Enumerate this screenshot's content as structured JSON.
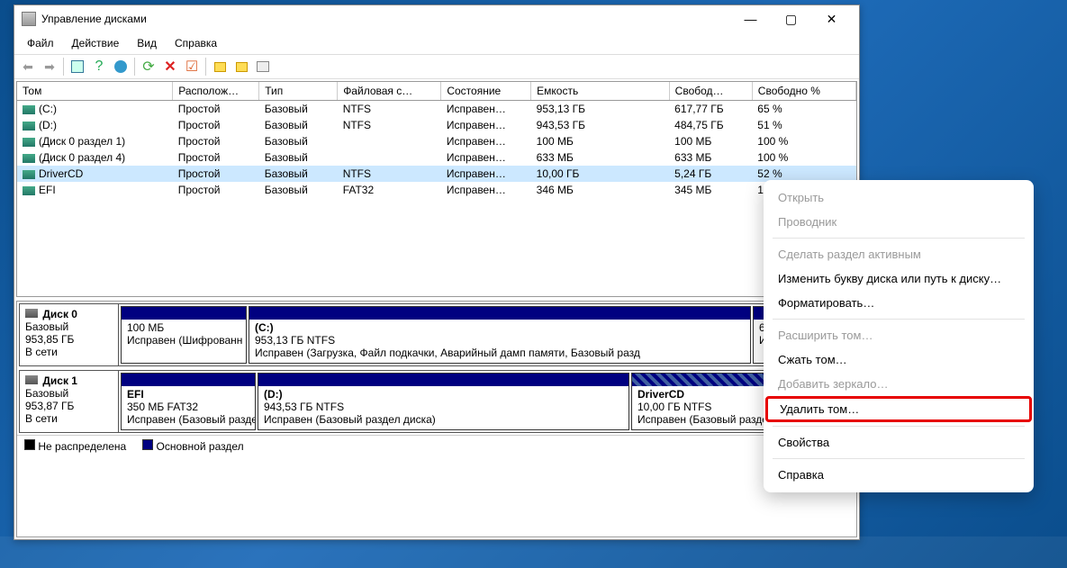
{
  "window": {
    "title": "Управление дисками",
    "controls": {
      "min": "—",
      "max": "▢",
      "close": "✕"
    }
  },
  "menubar": [
    "Файл",
    "Действие",
    "Вид",
    "Справка"
  ],
  "columns": {
    "c0": "Том",
    "c1": "Располож…",
    "c2": "Тип",
    "c3": "Файловая с…",
    "c4": "Состояние",
    "c5": "Емкость",
    "c6": "Свобод…",
    "c7": "Свободно %"
  },
  "volumes": [
    {
      "name": "(C:)",
      "layout": "Простой",
      "type": "Базовый",
      "fs": "NTFS",
      "status": "Исправен…",
      "cap": "953,13 ГБ",
      "free": "617,77 ГБ",
      "pct": "65 %"
    },
    {
      "name": "(D:)",
      "layout": "Простой",
      "type": "Базовый",
      "fs": "NTFS",
      "status": "Исправен…",
      "cap": "943,53 ГБ",
      "free": "484,75 ГБ",
      "pct": "51 %"
    },
    {
      "name": "(Диск 0 раздел 1)",
      "layout": "Простой",
      "type": "Базовый",
      "fs": "",
      "status": "Исправен…",
      "cap": "100 МБ",
      "free": "100 МБ",
      "pct": "100 %"
    },
    {
      "name": "(Диск 0 раздел 4)",
      "layout": "Простой",
      "type": "Базовый",
      "fs": "",
      "status": "Исправен…",
      "cap": "633 МБ",
      "free": "633 МБ",
      "pct": "100 %"
    },
    {
      "name": "DriverCD",
      "layout": "Простой",
      "type": "Базовый",
      "fs": "NTFS",
      "status": "Исправен…",
      "cap": "10,00 ГБ",
      "free": "5,24 ГБ",
      "pct": "52 %",
      "selected": true
    },
    {
      "name": "EFI",
      "layout": "Простой",
      "type": "Базовый",
      "fs": "FAT32",
      "status": "Исправен…",
      "cap": "346 МБ",
      "free": "345 МБ",
      "pct": "100 %"
    }
  ],
  "disks": {
    "d0": {
      "label": "Диск 0",
      "type": "Базовый",
      "size": "953,85 ГБ",
      "status": "В сети",
      "p0": {
        "title": "",
        "sub": "100 МБ",
        "desc": "Исправен (Шифрованн"
      },
      "p1": {
        "title": "(C:)",
        "sub": "953,13 ГБ NTFS",
        "desc": "Исправен (Загрузка, Файл подкачки, Аварийный дамп памяти, Базовый разд"
      },
      "p2": {
        "title": "",
        "sub": "633 МБ",
        "desc": "Исправен (Разде."
      }
    },
    "d1": {
      "label": "Диск 1",
      "type": "Базовый",
      "size": "953,87 ГБ",
      "status": "В сети",
      "p0": {
        "title": "EFI",
        "sub": "350 МБ FAT32",
        "desc": "Исправен (Базовый разде"
      },
      "p1": {
        "title": "(D:)",
        "sub": "943,53 ГБ NTFS",
        "desc": "Исправен (Базовый раздел диска)"
      },
      "p2": {
        "title": "DriverCD",
        "sub": "10,00 ГБ NTFS",
        "desc": "Исправен (Базовый раздел диска)"
      }
    }
  },
  "legend": {
    "unalloc": "Не распределена",
    "primary": "Основной раздел"
  },
  "context_menu": {
    "open": "Открыть",
    "explorer": "Проводник",
    "active": "Сделать раздел активным",
    "letter": "Изменить букву диска или путь к диску…",
    "format": "Форматировать…",
    "extend": "Расширить том…",
    "shrink": "Сжать том…",
    "mirror": "Добавить зеркало…",
    "delete": "Удалить том…",
    "props": "Свойства",
    "help": "Справка"
  }
}
